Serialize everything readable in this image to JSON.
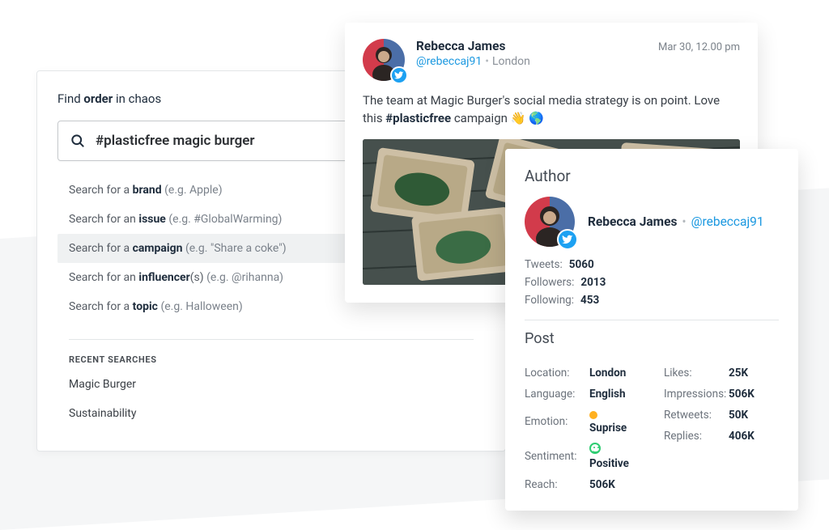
{
  "search": {
    "heading_prefix": "Find ",
    "heading_bold": "order",
    "heading_suffix": " in chaos",
    "value": "#plasticfree magic burger",
    "suggestions": [
      {
        "prefix": "Search for a ",
        "keyword": "brand",
        "suffix": "",
        "hint": " (e.g. Apple)",
        "selected": false
      },
      {
        "prefix": "Search for an ",
        "keyword": "issue",
        "suffix": "",
        "hint": " (e.g. #GlobalWarming)",
        "selected": false
      },
      {
        "prefix": "Search for a ",
        "keyword": "campaign",
        "suffix": "",
        "hint": " (e.g. \"Share a coke\")",
        "selected": true
      },
      {
        "prefix": "Search for an ",
        "keyword": "influencer",
        "suffix": "(s)",
        "hint": " (e.g. @rihanna)",
        "selected": false
      },
      {
        "prefix": "Search for a ",
        "keyword": "topic",
        "suffix": "",
        "hint": " (e.g. Halloween)",
        "selected": false
      }
    ],
    "recent_label": "RECENT SEARCHES",
    "recent": [
      "Magic Burger",
      "Sustainability"
    ]
  },
  "tweet": {
    "author_name": "Rebecca James",
    "handle": "@rebeccaj91",
    "location": "London",
    "date": "Mar 30, 12.00 pm",
    "body_pre": "The team at Magic Burger's social media strategy is on point. Love this ",
    "body_hashtag": "#plasticfree",
    "body_post": " campaign 👋 🌎"
  },
  "author_panel": {
    "heading": "Author",
    "name": "Rebecca James",
    "handle": "@rebeccaj91",
    "stats": {
      "tweets_label": "Tweets:",
      "tweets": "5060",
      "followers_label": "Followers:",
      "followers": "2013",
      "following_label": "Following:",
      "following": "453"
    }
  },
  "post_panel": {
    "heading": "Post",
    "left": {
      "location_label": "Location:",
      "location": "London",
      "language_label": "Language:",
      "language": "English",
      "emotion_label": "Emotion:",
      "emotion": "Suprise",
      "sentiment_label": "Sentiment:",
      "sentiment": "Positive",
      "reach_label": "Reach:",
      "reach": "506K"
    },
    "right": {
      "likes_label": "Likes:",
      "likes": "25K",
      "impressions_label": "Impressions:",
      "impressions": "506K",
      "retweets_label": "Retweets:",
      "retweets": "50K",
      "replies_label": "Replies:",
      "replies": "406K"
    }
  }
}
